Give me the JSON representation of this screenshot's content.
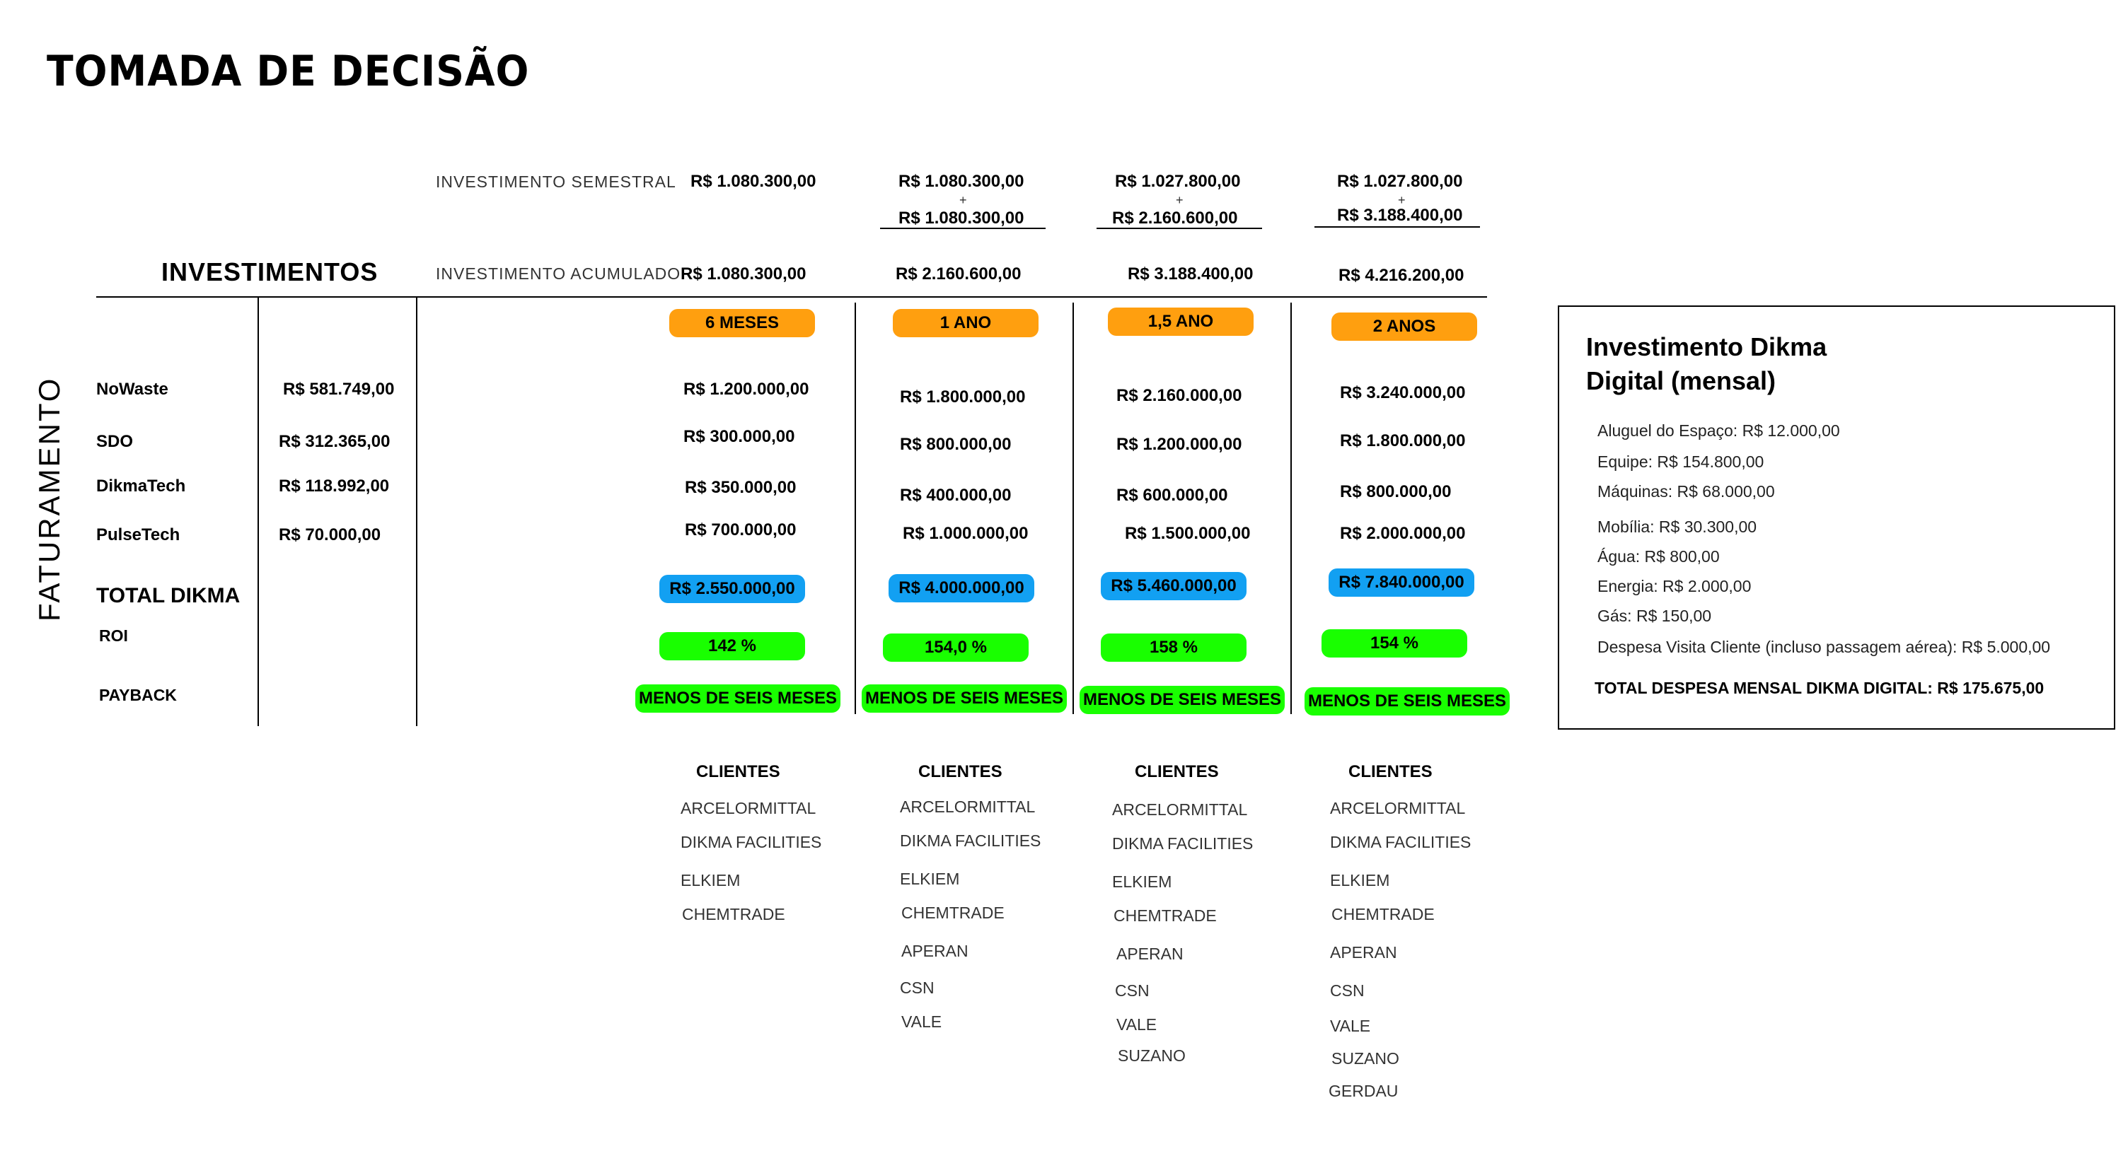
{
  "title": "TOMADA DE DECISÃO",
  "investimentos_label": "INVESTIMENTOS",
  "faturamento_label": "FATURAMENTO",
  "row_labels": {
    "semestral": "INVESTIMENTO  SEMESTRAL",
    "acumulado": "INVESTIMENTO  ACUMULADO"
  },
  "periods": [
    {
      "semestral_top": "R$ 1.080.300,00",
      "semestral_plus": "",
      "semestral_bottom": "",
      "acumulado": "R$ 1.080.300,00",
      "period_label": "6 MESES",
      "revenues": [
        "R$ 1.200.000,00",
        "R$ 300.000,00",
        "R$ 350.000,00",
        "R$ 700.000,00"
      ],
      "total": "R$ 2.550.000,00",
      "roi": "142 %",
      "payback": "MENOS DE SEIS MESES",
      "clients_header": "CLIENTES",
      "clients": [
        "ARCELORMITTAL",
        "DIKMA FACILITIES",
        "ELKIEM",
        "CHEMTRADE"
      ]
    },
    {
      "semestral_top": "R$ 1.080.300,00",
      "semestral_plus": "+",
      "semestral_bottom": "R$ 1.080.300,00",
      "acumulado": "R$ 2.160.600,00",
      "period_label": "1 ANO",
      "revenues": [
        "R$ 1.800.000,00",
        "R$ 800.000,00",
        "R$ 400.000,00",
        "R$ 1.000.000,00"
      ],
      "total": "R$ 4.000.000,00",
      "roi": "154,0 %",
      "payback": "MENOS DE SEIS MESES",
      "clients_header": "CLIENTES",
      "clients": [
        "ARCELORMITTAL",
        "DIKMA FACILITIES",
        "ELKIEM",
        "CHEMTRADE",
        "APERAN",
        "CSN",
        "VALE"
      ]
    },
    {
      "semestral_top": "R$ 1.027.800,00",
      "semestral_plus": "+",
      "semestral_bottom": "R$ 2.160.600,00",
      "acumulado": "R$ 3.188.400,00",
      "period_label": "1,5 ANO",
      "revenues": [
        "R$ 2.160.000,00",
        "R$ 1.200.000,00",
        "R$ 600.000,00",
        "R$ 1.500.000,00"
      ],
      "total": "R$ 5.460.000,00",
      "roi": "158 %",
      "payback": "MENOS DE SEIS MESES",
      "clients_header": "CLIENTES",
      "clients": [
        "ARCELORMITTAL",
        "DIKMA FACILITIES",
        "ELKIEM",
        "CHEMTRADE",
        "APERAN",
        "CSN",
        "VALE",
        "SUZANO"
      ]
    },
    {
      "semestral_top": "R$ 1.027.800,00",
      "semestral_plus": "+",
      "semestral_bottom": "R$ 3.188.400,00",
      "acumulado": "R$ 4.216.200,00",
      "period_label": "2 ANOS",
      "revenues": [
        "R$ 3.240.000,00",
        "R$ 1.800.000,00",
        "R$ 800.000,00",
        "R$ 2.000.000,00"
      ],
      "total": "R$ 7.840.000,00",
      "roi": "154 %",
      "payback": "MENOS DE SEIS MESES",
      "clients_header": "CLIENTES",
      "clients": [
        "ARCELORMITTAL",
        "DIKMA FACILITIES",
        "ELKIEM",
        "CHEMTRADE",
        "APERAN",
        "CSN",
        "VALE",
        "SUZANO",
        "GERDAU"
      ]
    }
  ],
  "companies": [
    {
      "name": "NoWaste",
      "base": "R$ 581.749,00"
    },
    {
      "name": "SDO",
      "base": "R$ 312.365,00"
    },
    {
      "name": "DikmaTech",
      "base": "R$ 118.992,00"
    },
    {
      "name": "PulseTech",
      "base": "R$ 70.000,00"
    }
  ],
  "total_label": "TOTAL DIKMA",
  "roi_label": "ROI",
  "payback_label": "PAYBACK",
  "box": {
    "title_line1": "Investimento Dikma",
    "title_line2": "Digital (mensal)",
    "items": [
      "Aluguel do Espaço:   R$ 12.000,00",
      "Equipe:  R$ 154.800,00",
      "Máquinas:  R$ 68.000,00",
      "Mobília:   R$ 30.300,00",
      "Água:   R$ 800,00",
      "Energia:   R$ 2.000,00",
      "Gás:   R$ 150,00",
      "Despesa Visita Cliente (incluso passagem aérea):   R$ 5.000,00"
    ],
    "total": "TOTAL DESPESA MENSAL DIKMA DIGITAL: R$ 175.675,00"
  },
  "colors": {
    "period_pill": "#ff9f0f",
    "total_pill": "#12a0f2",
    "roi_pill": "#19ff00",
    "payback_pill": "#19ff00"
  }
}
